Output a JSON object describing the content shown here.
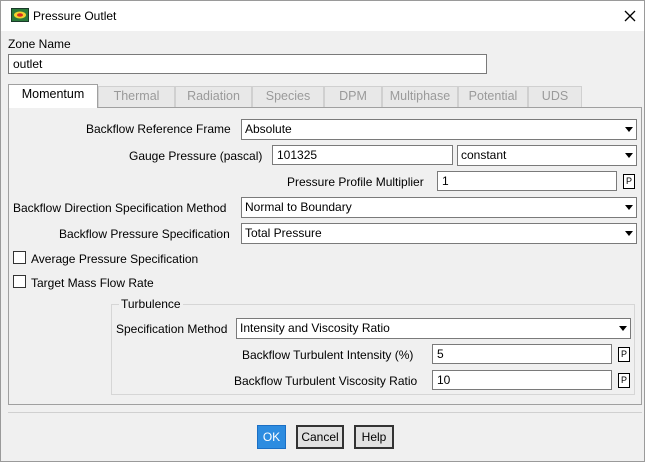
{
  "window": {
    "title": "Pressure Outlet"
  },
  "zone": {
    "label": "Zone Name",
    "value": "outlet"
  },
  "tabs": [
    "Momentum",
    "Thermal",
    "Radiation",
    "Species",
    "DPM",
    "Multiphase",
    "Potential",
    "UDS"
  ],
  "momentum": {
    "backflow_reference_frame": {
      "label": "Backflow Reference Frame",
      "value": "Absolute"
    },
    "gauge_pressure": {
      "label": "Gauge Pressure (pascal)",
      "value": "101325",
      "method": "constant"
    },
    "pressure_profile_multiplier": {
      "label": "Pressure Profile Multiplier",
      "value": "1",
      "p": "P"
    },
    "backflow_direction": {
      "label": "Backflow Direction Specification Method",
      "value": "Normal to Boundary"
    },
    "backflow_pressure": {
      "label": "Backflow Pressure Specification",
      "value": "Total Pressure"
    },
    "average_pressure": {
      "label": "Average Pressure Specification",
      "checked": false
    },
    "target_mass_flow": {
      "label": "Target Mass Flow Rate",
      "checked": false
    }
  },
  "turbulence": {
    "title": "Turbulence",
    "spec_method": {
      "label": "Specification Method",
      "value": "Intensity and Viscosity Ratio"
    },
    "intensity": {
      "label": "Backflow Turbulent Intensity (%)",
      "value": "5",
      "p": "P"
    },
    "viscosity_ratio": {
      "label": "Backflow Turbulent Viscosity Ratio",
      "value": "10",
      "p": "P"
    }
  },
  "buttons": {
    "ok": "OK",
    "cancel": "Cancel",
    "help": "Help"
  },
  "icons": {
    "app": "fluent-app-icon",
    "close": "close-icon"
  },
  "colors": {
    "default_button": "#2d8ce0",
    "panel_bg": "#f0f0f0"
  }
}
